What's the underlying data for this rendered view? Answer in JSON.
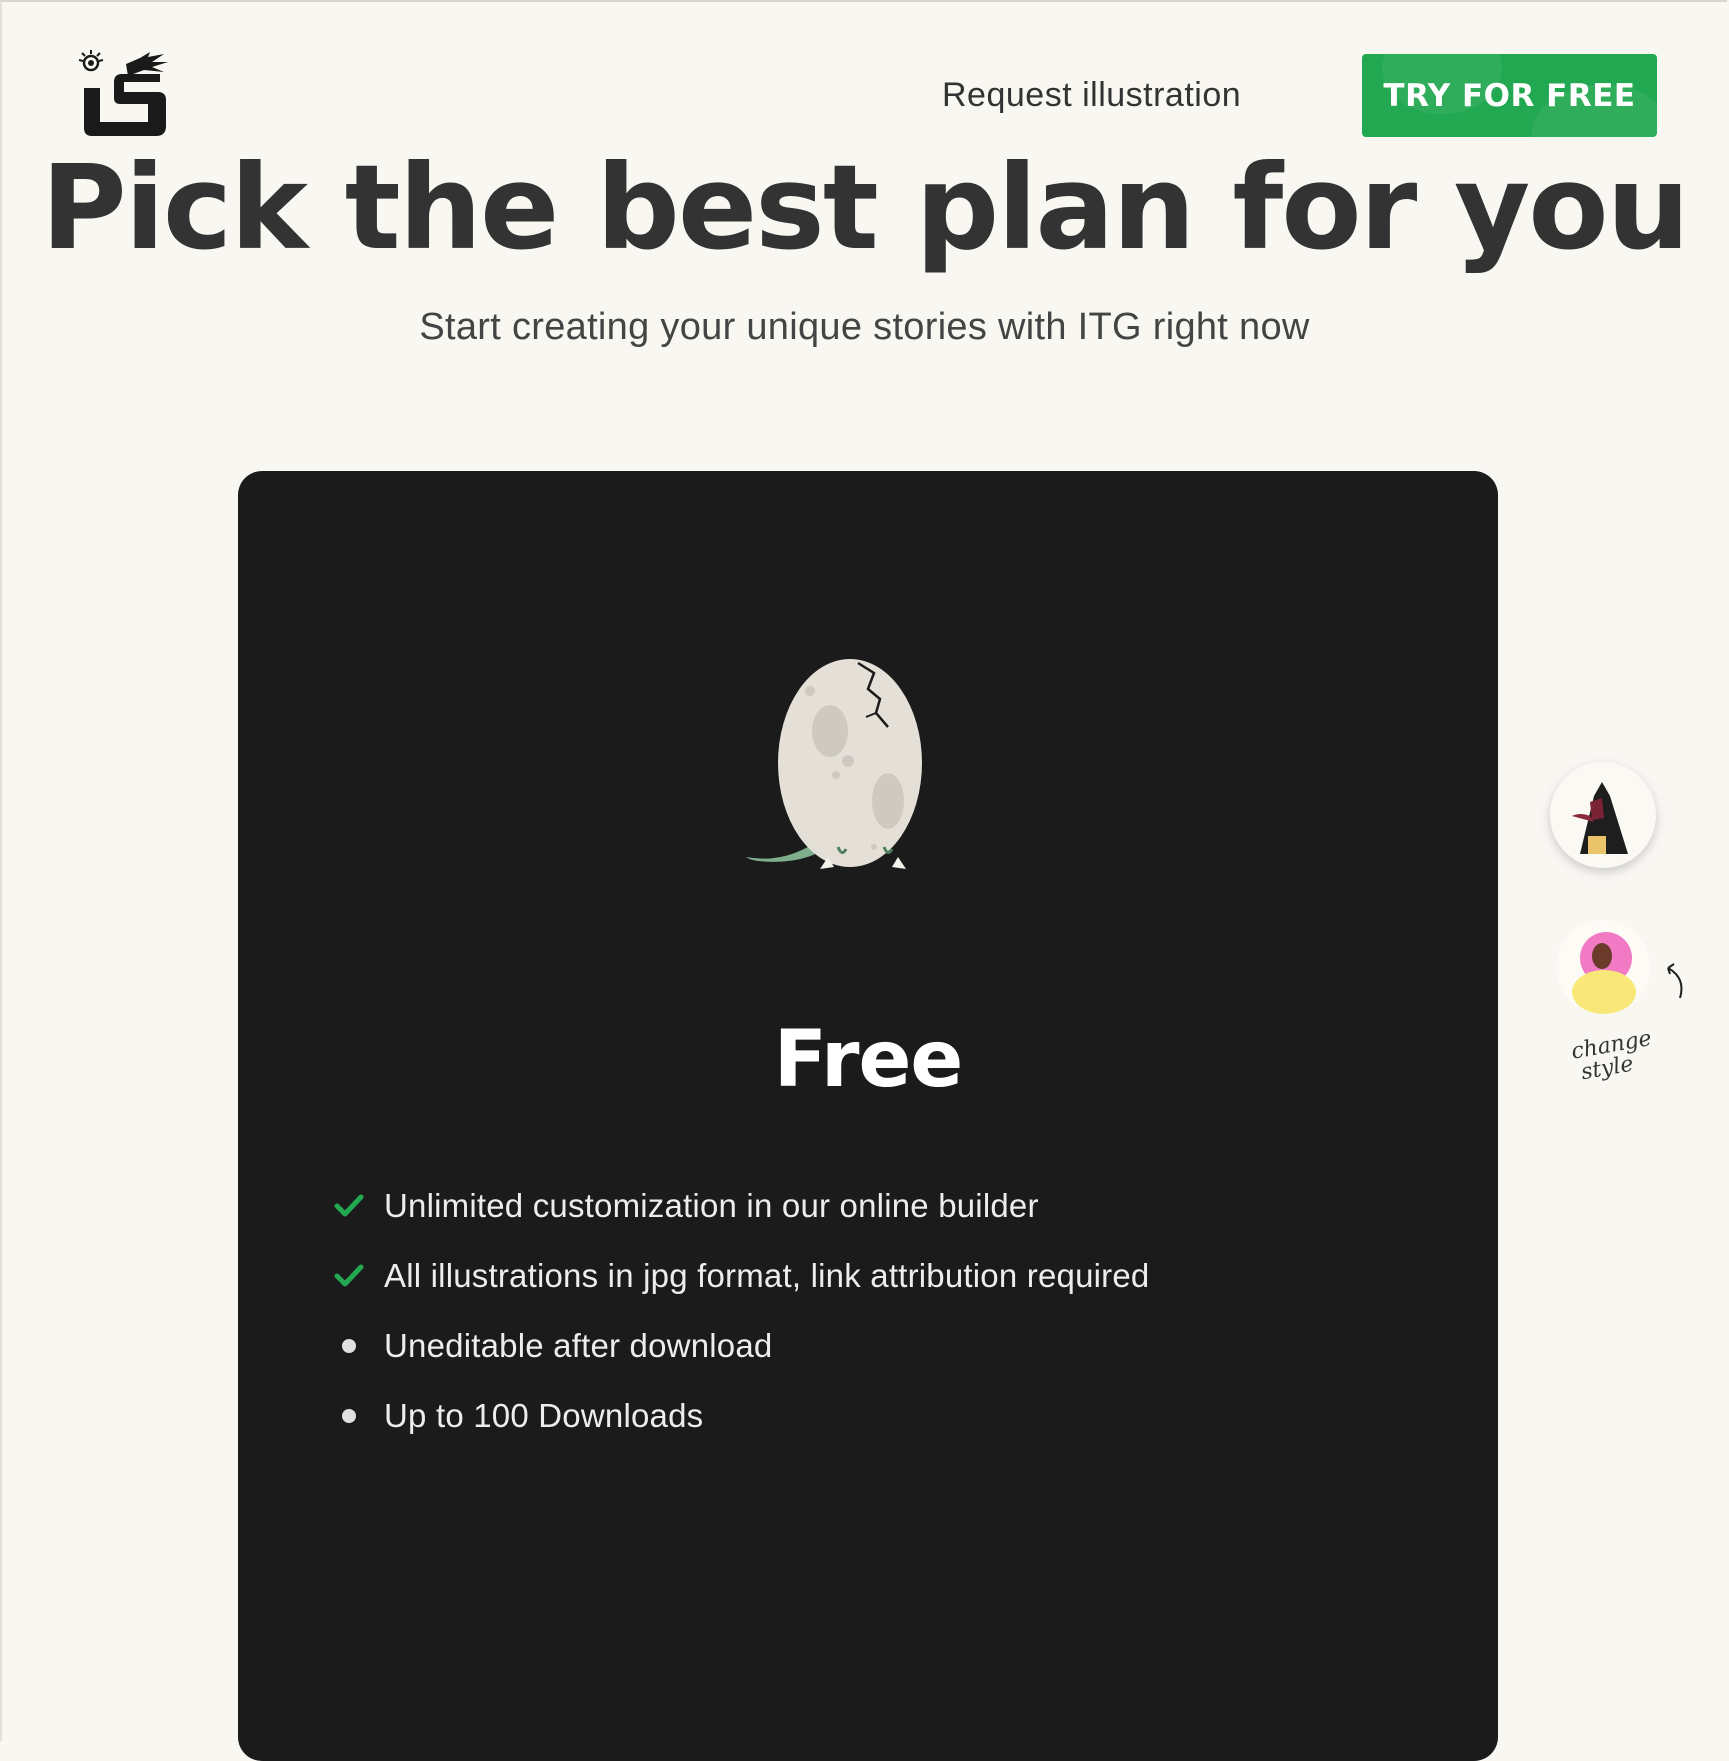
{
  "header": {
    "nav_link": "Request illustration",
    "cta": "TRY FOR FREE"
  },
  "hero": {
    "title": "Pick the best plan for you",
    "subtitle": "Start creating your unique stories with ITG right now"
  },
  "plan": {
    "name": "Free",
    "features": [
      {
        "text": "Unlimited customization in our online builder",
        "icon": "check-icon",
        "included": true
      },
      {
        "text": "All illustrations in jpg format, link attribution required",
        "icon": "check-icon",
        "included": true
      },
      {
        "text": "Uneditable after download",
        "icon": "bullet-icon",
        "included": false
      },
      {
        "text": "Up to 100 Downloads",
        "icon": "bullet-icon",
        "included": false
      }
    ]
  },
  "style_switcher": {
    "label_line1": "change",
    "label_line2": "style"
  },
  "colors": {
    "background": "#f9f7f2",
    "accent_green": "#22a851",
    "card": "#1b1b1b",
    "heading": "#333333"
  }
}
